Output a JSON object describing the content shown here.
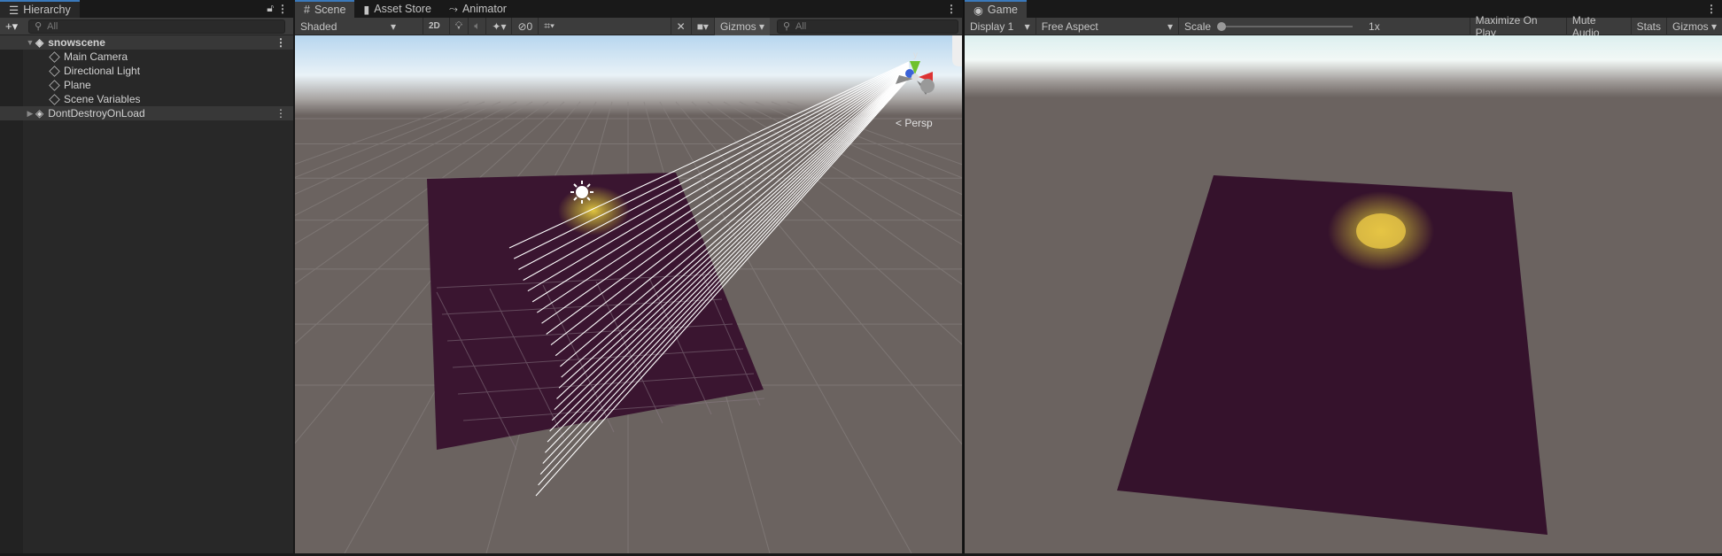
{
  "hierarchy": {
    "tab": "Hierarchy",
    "search_placeholder": "All",
    "add_label": "+▾",
    "scenes": [
      {
        "name": "snowscene",
        "children": [
          "Main Camera",
          "Directional Light",
          "Plane",
          "Scene Variables"
        ]
      },
      {
        "name": "DontDestroyOnLoad"
      }
    ]
  },
  "scene": {
    "tabs": [
      "Scene",
      "Asset Store",
      "Animator"
    ],
    "shading": "Shaded",
    "mode_2d": "2D",
    "hidden_count": "0",
    "gizmos": "Gizmos",
    "search_placeholder": "All",
    "projection": "Persp",
    "axis_y": "y"
  },
  "game": {
    "tab": "Game",
    "display": "Display 1",
    "aspect": "Free Aspect",
    "scale_label": "Scale",
    "scale_value": "1x",
    "maximize": "Maximize On Play",
    "mute": "Mute Audio",
    "stats": "Stats",
    "gizmos": "Gizmos"
  },
  "colors": {
    "accent": "#3a79bb",
    "plane": "#3a1530",
    "ground": "#6b6360"
  }
}
